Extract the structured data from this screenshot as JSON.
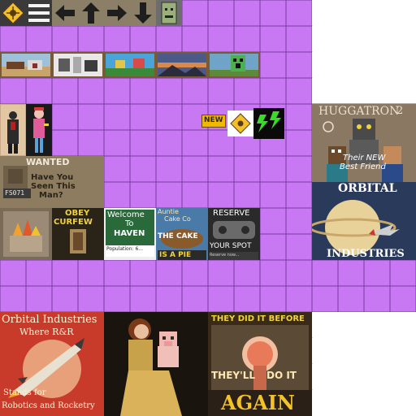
{
  "atlas": {
    "title": "",
    "colors": {
      "empty_cell": "#c778f2",
      "grid_line": "#7a3aa0",
      "transparent": "#ffffff"
    }
  },
  "icons": [
    {
      "name": "crosshair-icon"
    },
    {
      "name": "menu-lines-icon"
    },
    {
      "name": "arrow-left-icon"
    },
    {
      "name": "arrow-up-icon"
    },
    {
      "name": "arrow-right-icon"
    },
    {
      "name": "arrow-down-icon"
    },
    {
      "name": "smiley-face-icon"
    }
  ],
  "paintings_small": [
    {
      "name": "painting-kebab"
    },
    {
      "name": "painting-aztec"
    },
    {
      "name": "painting-alban"
    },
    {
      "name": "painting-sunset"
    },
    {
      "name": "painting-creeper"
    }
  ],
  "badges": {
    "new": "NEW",
    "lightning_icon": "lightning-icon"
  },
  "posters": {
    "huggatron": {
      "title": "HUGGATRON",
      "number": "2",
      "caption_1": "Their NEW",
      "caption_2": "Best Friend"
    },
    "orbital_small": {
      "top": "ORBITAL",
      "bottom": "INDUSTRIES"
    },
    "wanted": {
      "title": "WANTED",
      "line_1": "Have You",
      "line_2": "Seen This",
      "line_3": "Man?",
      "plate": "FS071"
    },
    "obey": {
      "line_1": "OBEY",
      "line_2": "CURFEW"
    },
    "welcome": {
      "line_1": "Welcome",
      "line_2": "To",
      "line_3": "HAVEN",
      "population": "Population: 6..."
    },
    "cake": {
      "top_1": "Auntie",
      "top_2": "Cake Co",
      "middle": "THE CAKE",
      "bottom": "IS A PIE"
    },
    "reserve": {
      "top": "RESERVE",
      "bottom": "YOUR SPOT",
      "small": "Reserve now..."
    },
    "orbital_large": {
      "title": "Orbital Industries",
      "subtitle": "Where R&R",
      "line_1": "Stands for",
      "line_2": "Robotics and Rocketry"
    },
    "again": {
      "top": "THEY DID IT BEFORE",
      "middle_1": "THEY'LL",
      "middle_2": "DO IT",
      "bottom": "AGAIN"
    }
  }
}
